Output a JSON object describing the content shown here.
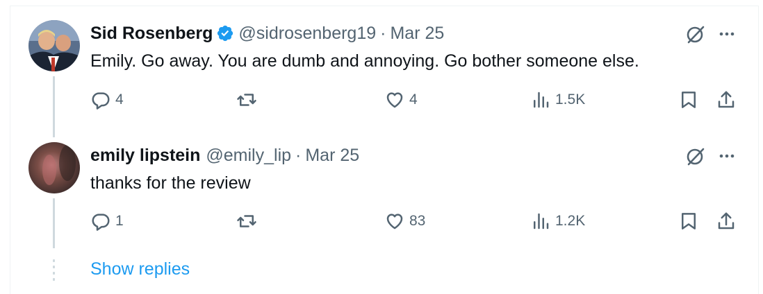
{
  "tweets": [
    {
      "name": "Sid Rosenberg",
      "verified": true,
      "handle": "@sidrosenberg19",
      "date": "Mar 25",
      "text": "Emily. Go away. You are dumb and annoying. Go bother someone else.",
      "replies": "4",
      "retweets": "",
      "likes": "4",
      "views": "1.5K"
    },
    {
      "name": "emily lipstein",
      "verified": false,
      "handle": "@emily_lip",
      "date": "Mar 25",
      "text": "thanks for the review",
      "replies": "1",
      "retweets": "",
      "likes": "83",
      "views": "1.2K"
    }
  ],
  "show_replies_label": "Show replies",
  "separator": "·",
  "colors": {
    "accent": "#1d9bf0",
    "muted": "#536471",
    "text": "#0f1419",
    "line": "#cfd9de"
  },
  "icons": [
    "verified-badge-icon",
    "grok-icon",
    "more-icon",
    "reply-icon",
    "retweet-icon",
    "like-icon",
    "views-icon",
    "bookmark-icon",
    "share-icon"
  ]
}
